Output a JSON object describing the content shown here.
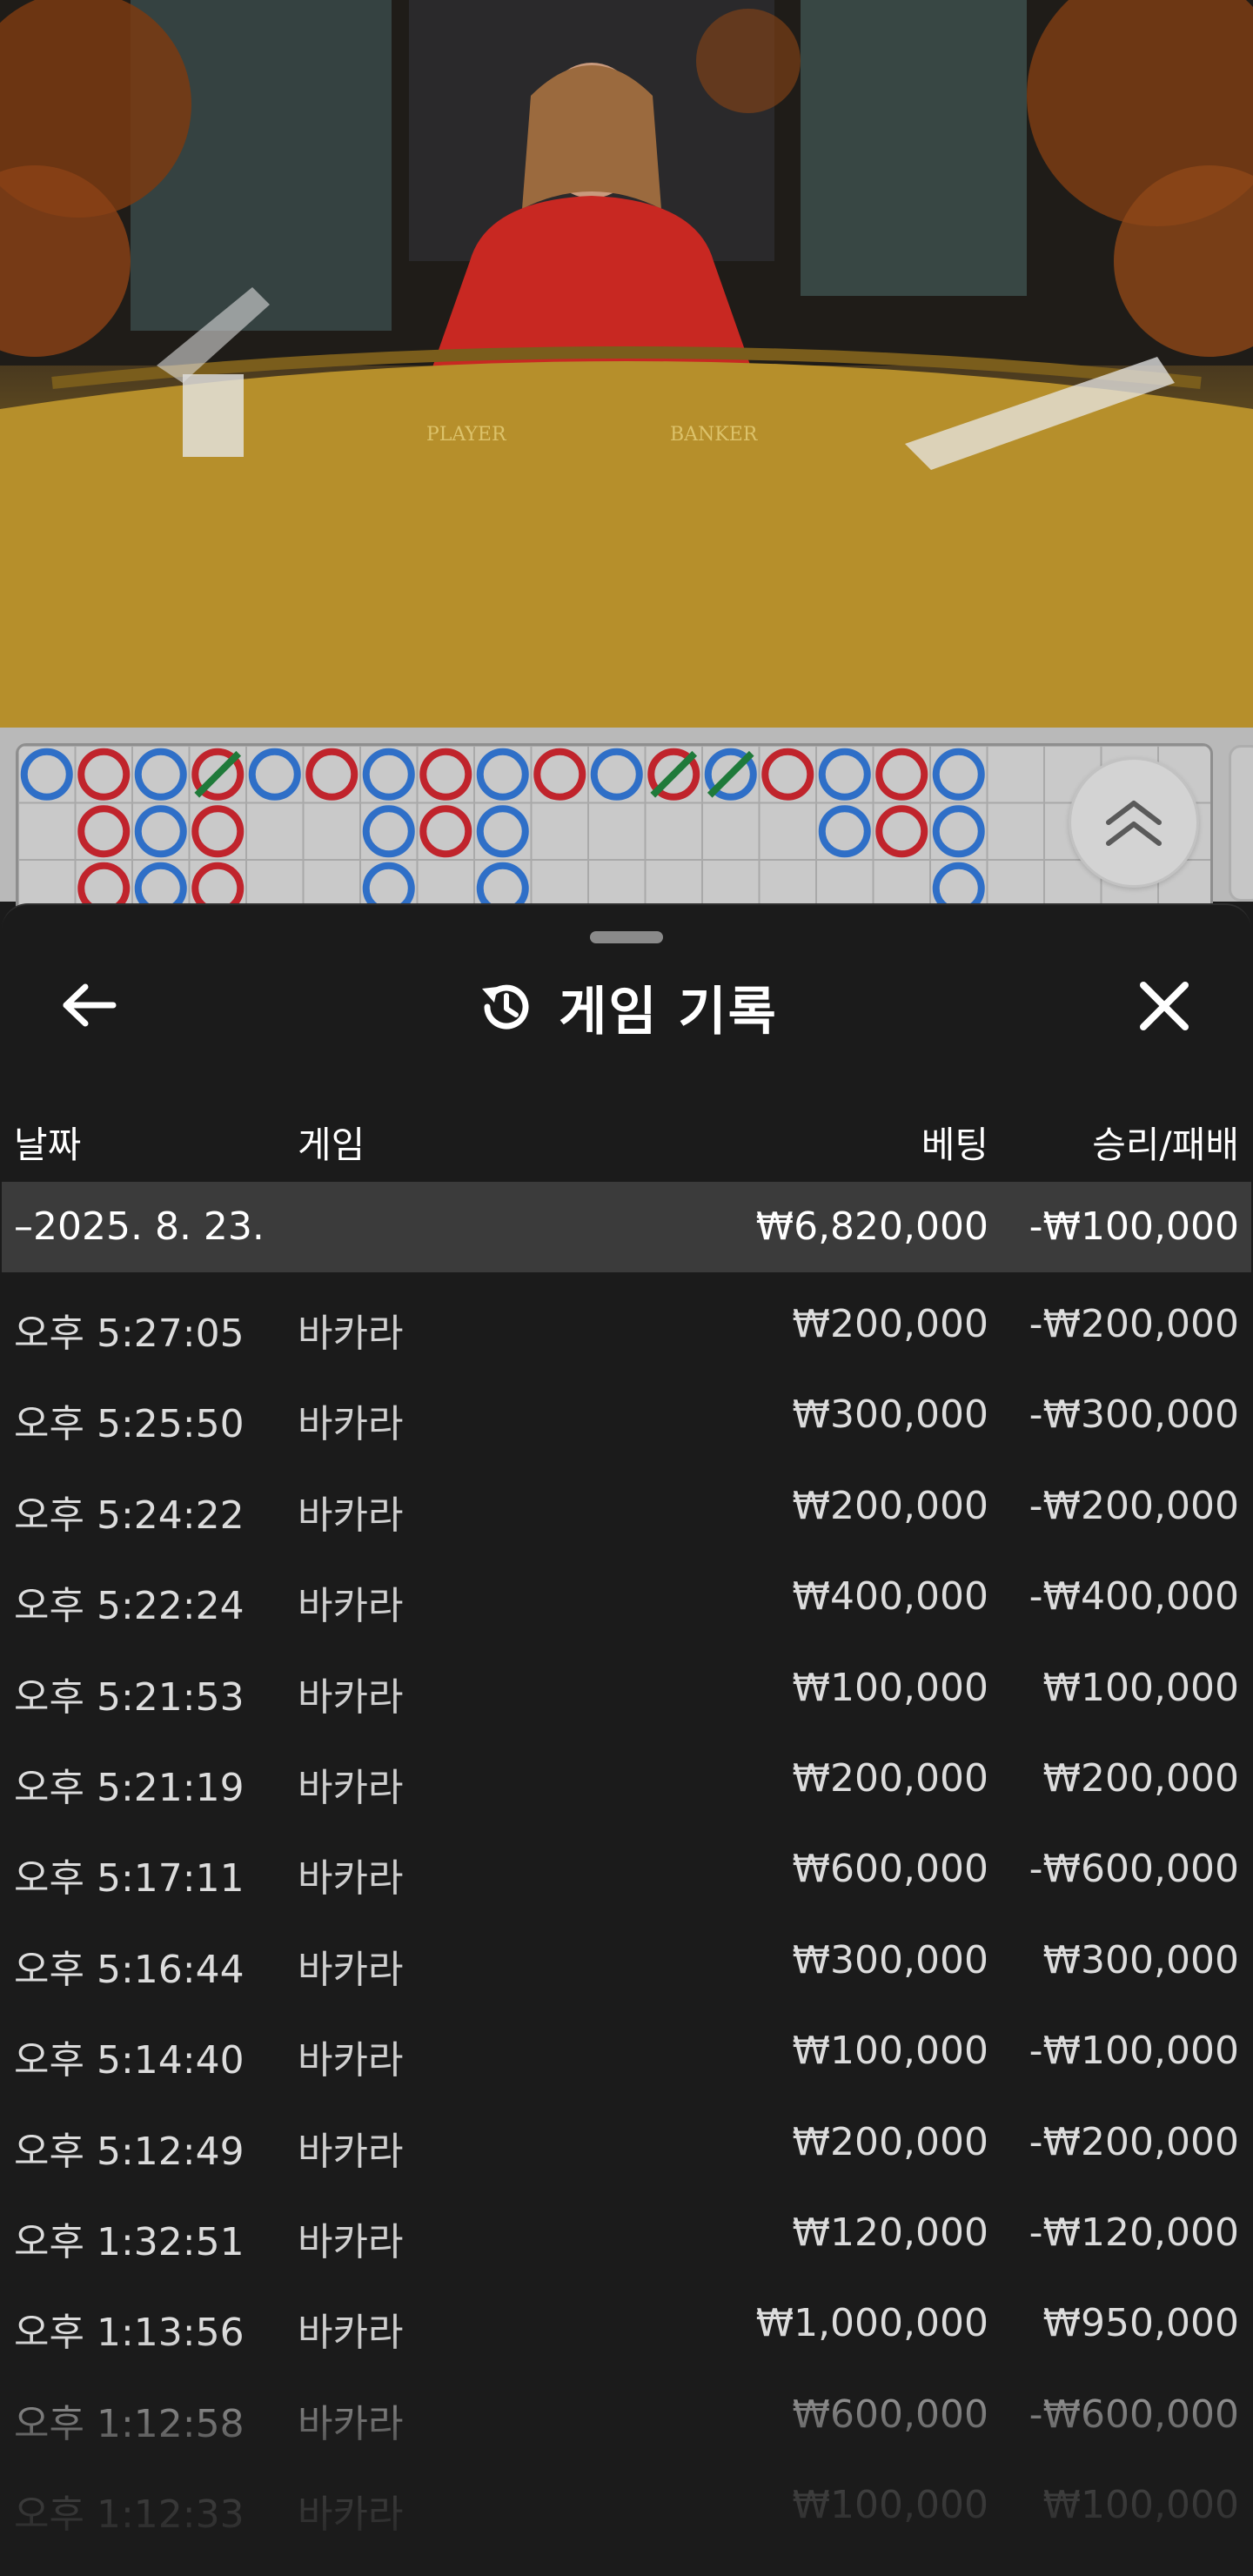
{
  "video": {
    "table_labels": {
      "player": "PLAYER",
      "banker": "BANKER"
    }
  },
  "roadmap": {
    "colors": {
      "player": "#2f6fc7",
      "banker": "#c0242c",
      "tie": "#1f7a3a"
    }
  },
  "sheet": {
    "title": "게임 기록",
    "icons": {
      "back": "arrow-left-icon",
      "history": "history-icon",
      "close": "close-icon"
    },
    "columns": {
      "date": "날짜",
      "game": "게임",
      "bet": "베팅",
      "win_loss": "승리/패배"
    },
    "day_summary": {
      "date": "–2025. 8. 23.",
      "bet": "₩6,820,000",
      "win_loss": "-₩100,000"
    },
    "rows": [
      {
        "time": "오후 5:27:05",
        "game": "바카라",
        "bet": "₩200,000",
        "win_loss": "-₩200,000"
      },
      {
        "time": "오후 5:25:50",
        "game": "바카라",
        "bet": "₩300,000",
        "win_loss": "-₩300,000"
      },
      {
        "time": "오후 5:24:22",
        "game": "바카라",
        "bet": "₩200,000",
        "win_loss": "-₩200,000"
      },
      {
        "time": "오후 5:22:24",
        "game": "바카라",
        "bet": "₩400,000",
        "win_loss": "-₩400,000"
      },
      {
        "time": "오후 5:21:53",
        "game": "바카라",
        "bet": "₩100,000",
        "win_loss": "₩100,000"
      },
      {
        "time": "오후 5:21:19",
        "game": "바카라",
        "bet": "₩200,000",
        "win_loss": "₩200,000"
      },
      {
        "time": "오후 5:17:11",
        "game": "바카라",
        "bet": "₩600,000",
        "win_loss": "-₩600,000"
      },
      {
        "time": "오후 5:16:44",
        "game": "바카라",
        "bet": "₩300,000",
        "win_loss": "₩300,000"
      },
      {
        "time": "오후 5:14:40",
        "game": "바카라",
        "bet": "₩100,000",
        "win_loss": "-₩100,000"
      },
      {
        "time": "오후 5:12:49",
        "game": "바카라",
        "bet": "₩200,000",
        "win_loss": "-₩200,000"
      },
      {
        "time": "오후 1:32:51",
        "game": "바카라",
        "bet": "₩120,000",
        "win_loss": "-₩120,000"
      },
      {
        "time": "오후 1:13:56",
        "game": "바카라",
        "bet": "₩1,000,000",
        "win_loss": "₩950,000"
      },
      {
        "time": "오후 1:12:58",
        "game": "바카라",
        "bet": "₩600,000",
        "win_loss": "-₩600,000"
      },
      {
        "time": "오후 1:12:33",
        "game": "바카라",
        "bet": "₩100,000",
        "win_loss": "₩100,000"
      }
    ]
  }
}
